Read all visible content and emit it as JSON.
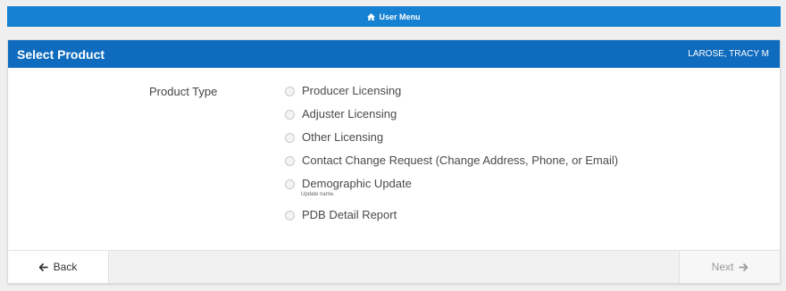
{
  "header": {
    "user_menu_label": "User Menu",
    "icon": "home-icon"
  },
  "panel": {
    "title": "Select Product",
    "user_name": "LAROSE, TRACY M"
  },
  "form": {
    "field_label": "Product Type",
    "options": [
      {
        "label": "Producer Licensing"
      },
      {
        "label": "Adjuster Licensing"
      },
      {
        "label": "Other Licensing"
      },
      {
        "label": "Contact Change Request (Change Address, Phone, or Email)"
      },
      {
        "label": "Demographic Update",
        "hint": "Update name."
      },
      {
        "label": "PDB Detail Report"
      }
    ]
  },
  "footer": {
    "back_label": "Back",
    "next_label": "Next"
  },
  "colors": {
    "menu_bar": "#1680d2",
    "panel_header": "#0f6bbd"
  }
}
